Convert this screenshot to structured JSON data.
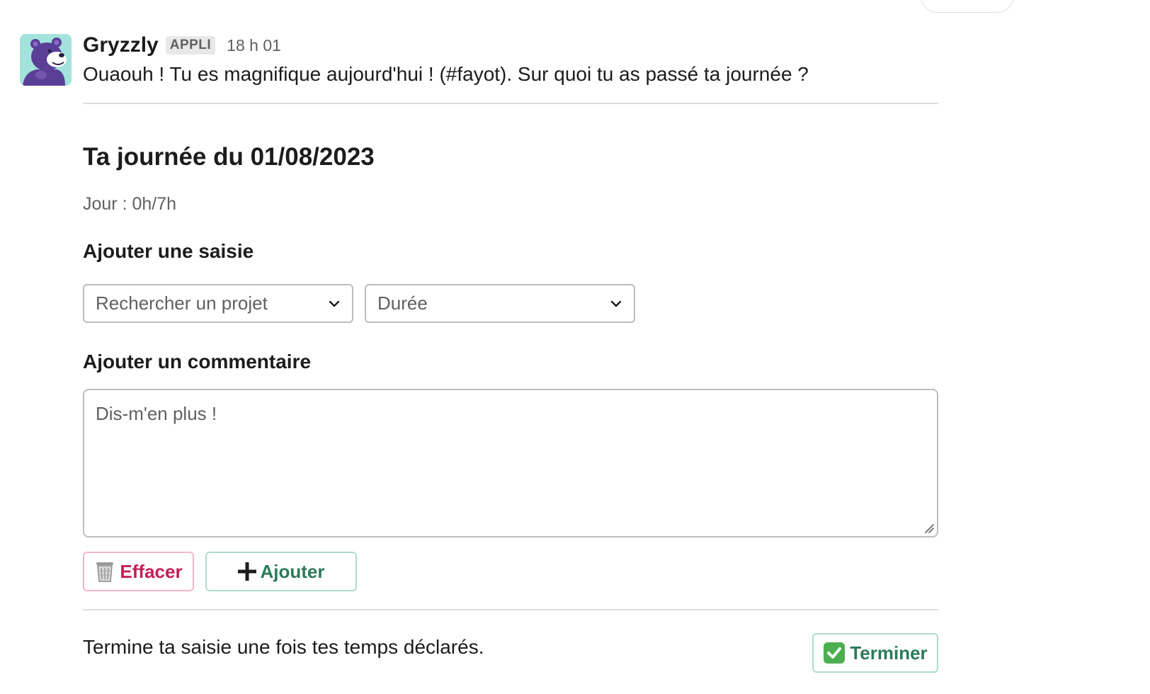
{
  "message": {
    "sender": "Gryzzly",
    "badge": "APPLI",
    "timestamp": "18 h 01",
    "text": "Ouaouh ! Tu es magnifique aujourd'hui ! (#fayot). Sur quoi tu as passé ta journée ?"
  },
  "form": {
    "title": "Ta journée du 01/08/2023",
    "day_summary": "Jour : 0h/7h",
    "entry_label": "Ajouter une saisie",
    "project_select": {
      "placeholder": "Rechercher un projet",
      "icon": "chevron-down-icon"
    },
    "duration_select": {
      "placeholder": "Durée",
      "icon": "chevron-down-icon"
    },
    "comment_label": "Ajouter un commentaire",
    "comment_placeholder": "Dis-m'en plus !",
    "clear_button": {
      "label": "Effacer",
      "icon": "wastebasket-icon"
    },
    "add_button": {
      "label": "Ajouter",
      "icon": "plus-icon"
    }
  },
  "footer": {
    "text": "Termine ta saisie une fois tes temps déclarés.",
    "finish_button": {
      "label": "Terminer",
      "icon": "check-mark-button-icon"
    }
  },
  "colors": {
    "danger": "#c41e56",
    "success": "#2c7a5b",
    "avatar_bg": "#a3e3dc",
    "bear": "#5b3e96"
  }
}
